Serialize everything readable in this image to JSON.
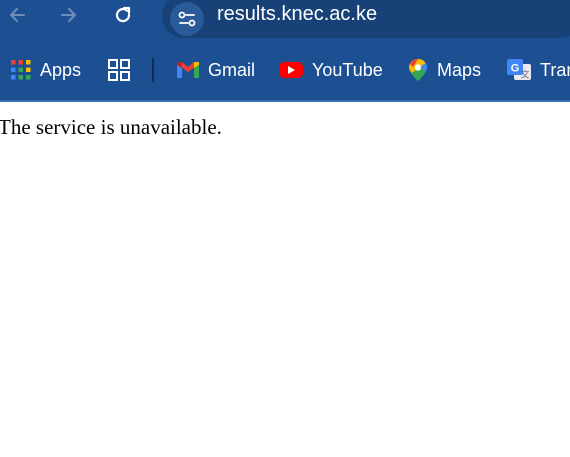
{
  "browser": {
    "url": "results.knec.ac.ke",
    "bookmarks": [
      {
        "label": "Apps",
        "icon": "apps-grid-icon"
      },
      {
        "label": "",
        "icon": "tab-groups-icon"
      },
      {
        "label": "Gmail",
        "icon": "gmail-icon"
      },
      {
        "label": "YouTube",
        "icon": "youtube-icon"
      },
      {
        "label": "Maps",
        "icon": "maps-pin-icon"
      },
      {
        "label": "Tran",
        "icon": "translate-icon"
      }
    ],
    "colors": {
      "toolbar": "#1d5093",
      "omnibox": "#174177",
      "text": "#ffffff"
    }
  },
  "page": {
    "message": "The service is unavailable."
  }
}
